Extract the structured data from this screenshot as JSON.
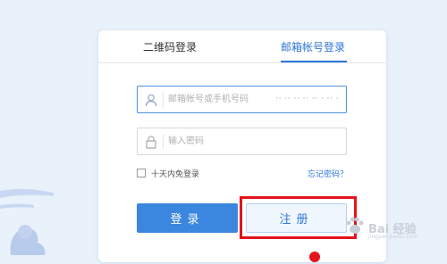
{
  "tabs": {
    "qr_login": "二维码登录",
    "email_login": "邮箱帐号登录"
  },
  "account_field": {
    "placeholder": "邮箱帐号或手机号码",
    "value": "·· ·· ·· ·· ·· · ·· ·"
  },
  "password_field": {
    "placeholder": "输入密码"
  },
  "remember": {
    "label": "十天内免登录",
    "checked": false
  },
  "forgot_password": "忘记密码？",
  "buttons": {
    "login": "登录",
    "register": "注册"
  },
  "colors": {
    "accent": "#2f76d8",
    "login_button": "#3b86de",
    "highlight": "#e3141c",
    "background": "#e9f1fb"
  },
  "icons": {
    "account": "user-icon",
    "password": "lock-icon",
    "watermark": "paw-icon"
  },
  "watermark": {
    "text": "Bai 经验",
    "sub": "jingyan.baidu.com"
  }
}
